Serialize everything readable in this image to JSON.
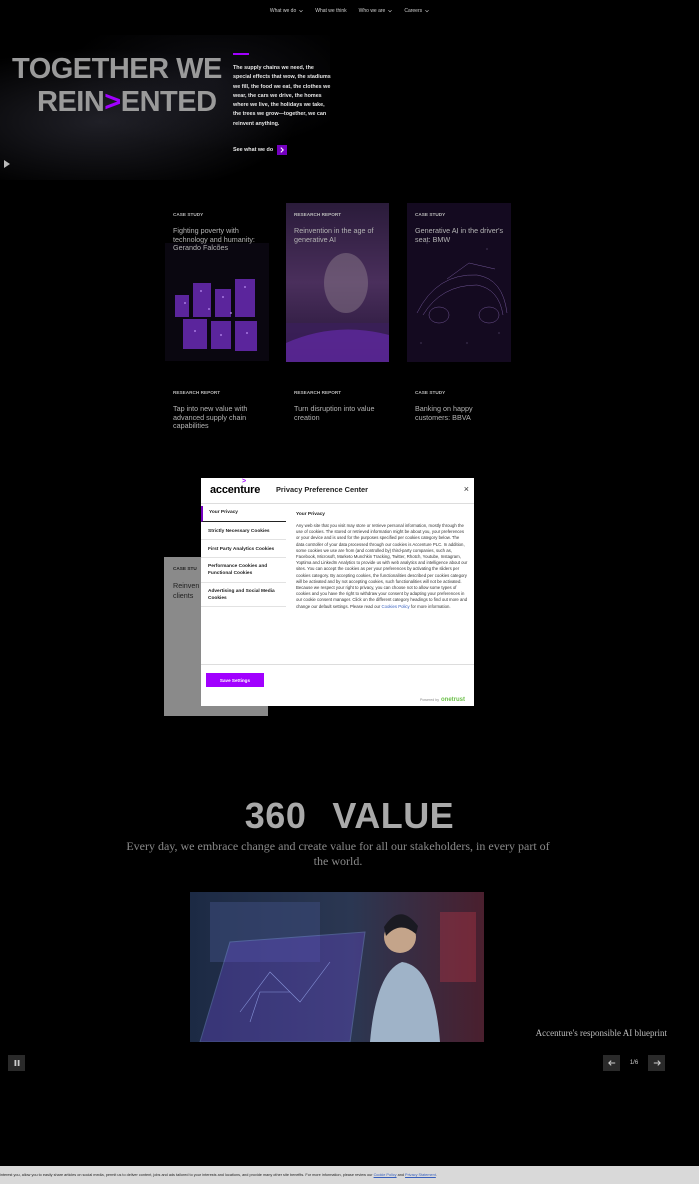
{
  "nav": {
    "items": [
      {
        "label": "What we do"
      },
      {
        "label": "What we think"
      },
      {
        "label": "Who we are"
      },
      {
        "label": "Careers"
      }
    ]
  },
  "hero": {
    "title_line1": "TOGETHER WE",
    "title_line2_a": "REIN",
    "title_line2_b": ">",
    "title_line2_c": "ENTED",
    "copy": "The supply chains we need, the special effects that wow, the stadiums we fill, the food we eat, the clothes we wear, the cars we drive, the homes where we live, the holidays we take, the trees we grow—together, we can reinvent anything.",
    "cta": "See what we do"
  },
  "cards": [
    {
      "tag": "CASE STUDY",
      "title": "Fighting poverty with technology and humanity: Gerando Falcões"
    },
    {
      "tag": "RESEARCH REPORT",
      "title": "Reinvention in the age of generative AI"
    },
    {
      "tag": "CASE STUDY",
      "title": "Generative AI in the driver's seat: BMW"
    },
    {
      "tag": "RESEARCH REPORT",
      "title": "Tap into new value with advanced supply chain capabilities"
    },
    {
      "tag": "RESEARCH REPORT",
      "title": "Turn disruption into value creation"
    },
    {
      "tag": "CASE STUDY",
      "title": "Banking on happy customers: BBVA"
    }
  ],
  "hidden_card": {
    "tag": "CASE STU",
    "title_a": "Reinven",
    "title_b": "clients"
  },
  "modal": {
    "logo": "accenture",
    "title": "Privacy Preference Center",
    "close": "×",
    "tabs": [
      "Your Privacy",
      "Strictly Necessary Cookies",
      "First Party Analytics Cookies",
      "Performance Cookies and Functional Cookies",
      "Advertising and Social Media Cookies"
    ],
    "pane_title": "Your Privacy",
    "pane_body": "Any web site that you visit may store or retrieve personal information, mostly through the use of cookies. The stored or retrieved information might be about you, your preferences or your device and is used for the purposes specified per cookies category below. The data controller of your data processed through our cookies is Accenture PLC. In addition, some cookies we use are from (and controlled by) third-party companies, such as, Facebook, Microsoft, Marketo Munchkin Tracking, Twitter, Rhotch, Youtube, Instagram, Yoptima and LinkedIn Analytics to provide us with web analytics and intelligence about our sites. You can accept the cookies as per your preferences by activating the sliders per cookies category. By accepting cookies, the functionalities described per cookies category will be activated and by not accepting cookies, such functionalities will not be activated. Because we respect your right to privacy, you can choose not to allow some types of cookies and you have the right to withdraw your consent by adapting your preferences in our cookie consent manager. Click on the different category headings to find out more and change our default settings. Please read our ",
    "pane_link": "Cookies Policy",
    "pane_tail": " for more information.",
    "save_button": "Save Settings",
    "powered_by": "Powered by",
    "powered_brand": "onetrust"
  },
  "value": {
    "num": "360",
    "word": "VALUE",
    "subtitle": "Every day, we embrace change and create value for all our stakeholders, in every part of the world.",
    "caption": "Accenture's responsible AI blueprint",
    "pager": "1/6"
  },
  "cookie_bar": {
    "text": "interest you, allow you to easily share articles on social media, permit us to deliver content, jobs and ads tailored to your interests and locations, and provide many other site benefits. For more information, please review our ",
    "link1": "Cookie Policy",
    "and": " and ",
    "link2": "Privacy Statement",
    "end": "."
  },
  "colors": {
    "accent": "#a100ff",
    "accent_dark": "#7500c0",
    "background": "#000000"
  },
  "icons": [
    "chevron-down-icon",
    "arrow-right-icon",
    "play-icon",
    "pause-icon",
    "arrow-left-icon",
    "close-icon"
  ]
}
